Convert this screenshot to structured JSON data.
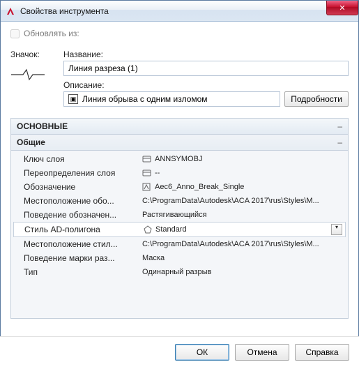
{
  "window": {
    "title": "Свойства инструмента",
    "close_glyph": "✕"
  },
  "update_from": {
    "label": "Обновлять из:",
    "checked": false
  },
  "icon_section": {
    "icon_label": "Значок:",
    "name_label": "Название:",
    "name_value": "Линия разреза (1)",
    "desc_label": "Описание:",
    "desc_value": "Линия обрыва с одним изломом",
    "details_button": "Подробности"
  },
  "categories": {
    "main": "ОСНОВНЫЕ",
    "general": "Общие"
  },
  "props": [
    {
      "key": "Ключ слоя",
      "icon": "layer",
      "value": "ANNSYMOBJ"
    },
    {
      "key": "Переопределения слоя",
      "icon": "layer",
      "value": "--"
    },
    {
      "key": "Обозначение",
      "icon": "symbol",
      "value": "Aec6_Anno_Break_Single"
    },
    {
      "key": "Местоположение обо...",
      "icon": "",
      "value": "C:\\ProgramData\\Autodesk\\ACA 2017\\rus\\Styles\\M..."
    },
    {
      "key": "Поведение обозначен...",
      "icon": "",
      "value": "Растягивающийся"
    },
    {
      "key": "Стиль AD-полигона",
      "icon": "polygon",
      "value": "Standard",
      "dropdown": true,
      "selected": true
    },
    {
      "key": "Местоположение стил...",
      "icon": "",
      "value": "C:\\ProgramData\\Autodesk\\ACA 2017\\rus\\Styles\\M..."
    },
    {
      "key": "Поведение марки раз...",
      "icon": "",
      "value": "Маска"
    },
    {
      "key": "Тип",
      "icon": "",
      "value": "Одинарный разрыв"
    }
  ],
  "buttons": {
    "ok": "ОК",
    "cancel": "Отмена",
    "help": "Справка"
  }
}
